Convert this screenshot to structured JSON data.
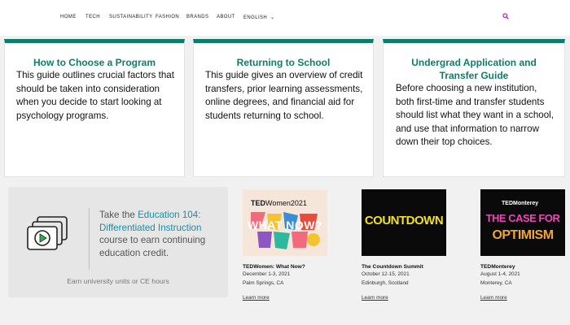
{
  "nav": {
    "items": [
      "HOME",
      "TECH",
      "SUSTAINABILITY",
      "FASHION",
      "BRANDS",
      "ABOUT",
      "ENGLISH"
    ],
    "language_chevron": "⌄",
    "search_icon": "search-icon",
    "accent": "#c020c0"
  },
  "guides": [
    {
      "title": "How to Choose a Program",
      "body": "This guide outlines crucial factors that should be taken into consideration when you decide to start looking at psychology programs."
    },
    {
      "title": "Returning to School",
      "body": "This guide gives an overview of credit transfers, prior learning assessments, online degrees, and financial aid for students returning to school."
    },
    {
      "title": "Undergrad Application and Transfer Guide",
      "body": "Before choosing a new institution, both first-time and transfer students should list what they want in a school, and use that information to narrow down their top choices."
    }
  ],
  "promo": {
    "prefix": "Take the ",
    "course": "Education 104: Differentiated Instruction",
    "suffix": " course to earn continuing education credit.",
    "footer": "Earn university units or CE hours",
    "icon": "video-stack-icon"
  },
  "events": [
    {
      "thumb": {
        "brand": "TED",
        "brand_suffix": "Women2021",
        "art": "WHAT NOW?"
      },
      "title": "TEDWomen: What Now?",
      "dates": "December 1-3, 2021",
      "place": "Palm Springs, CA",
      "link": "Learn more"
    },
    {
      "thumb": {
        "art": "COUNTDOWN"
      },
      "title": "The Countdown Summit",
      "dates": "October 12-15, 2021",
      "place": "Edinburgh, Scotland",
      "link": "Learn more"
    },
    {
      "thumb": {
        "brand": "TEDMonterey",
        "art_lines": [
          "THE CASE FOR",
          "OPTIMISM"
        ]
      },
      "title": "TEDMonterey",
      "dates": "August 1-4, 2021",
      "place": "Monterey, CA",
      "link": "Learn more"
    }
  ],
  "colors": {
    "brand_green": "#0e7c6b",
    "link_teal": "#1a8ea4",
    "countdown_yellow": "#f3e11d"
  }
}
